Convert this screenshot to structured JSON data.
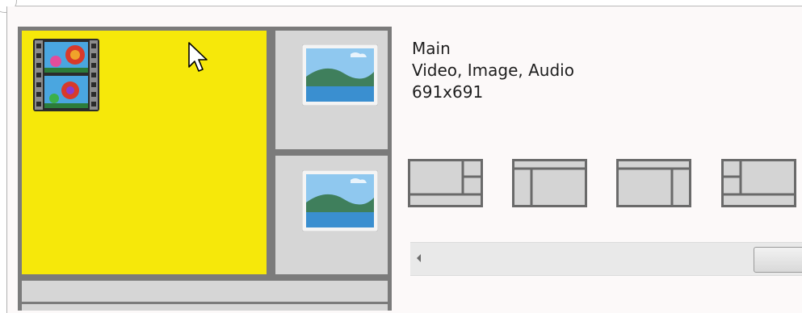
{
  "window": {
    "border_color": "#b9b9b9"
  },
  "preview": {
    "zones": [
      {
        "name": "main",
        "content": "video",
        "highlight_color": "#f6e80a"
      },
      {
        "name": "right-top",
        "content": "image"
      },
      {
        "name": "right-bottom",
        "content": "image"
      },
      {
        "name": "bottom",
        "content": "empty"
      }
    ],
    "icons": {
      "video": "film-strip-icon",
      "image": "landscape-image-icon",
      "cursor": "mouse-pointer-icon"
    }
  },
  "zone_info": {
    "name": "Main",
    "content_types": "Video, Image, Audio",
    "resolution": "691x691"
  },
  "layout_options": [
    {
      "id": "layout-main-left-split-right"
    },
    {
      "id": "layout-top-bar-left-strip"
    },
    {
      "id": "layout-top-bar-right-strip"
    },
    {
      "id": "layout-left-split-main-right"
    }
  ],
  "scrollbar": {
    "orientation": "horizontal"
  }
}
